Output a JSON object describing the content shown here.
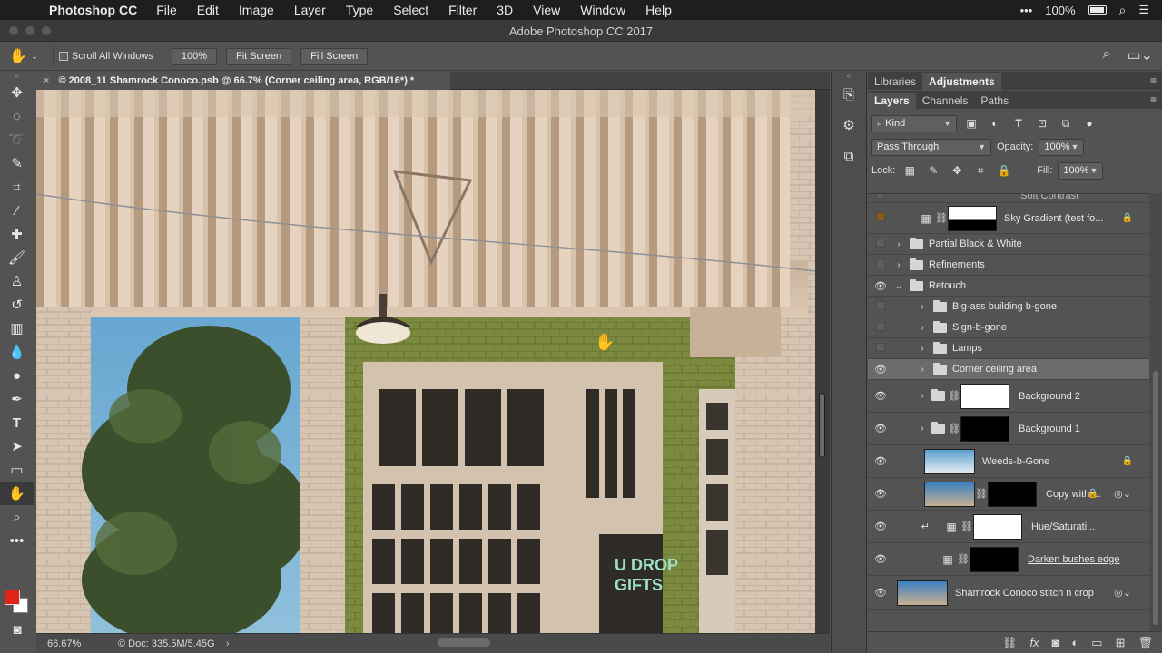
{
  "menubar": {
    "app_name": "Photoshop CC",
    "items": [
      "File",
      "Edit",
      "Image",
      "Layer",
      "Type",
      "Select",
      "Filter",
      "3D",
      "View",
      "Window",
      "Help"
    ],
    "battery": "100%"
  },
  "window": {
    "title": "Adobe Photoshop CC 2017"
  },
  "options": {
    "scroll_all_windows": "Scroll All Windows",
    "zoom_btn": "100%",
    "fit_screen": "Fit Screen",
    "fill_screen": "Fill Screen"
  },
  "document": {
    "tab_title": "© 2008_11 Shamrock Conoco.psb @ 66.7% (Corner ceiling area, RGB/16*) *",
    "zoom": "66.67%",
    "doc_size": "Doc: 335.5M/5.45G"
  },
  "canvas": {
    "sign_line1": "U DROP",
    "sign_line2": "GIFTS"
  },
  "panels": {
    "top_tabs": [
      "Libraries",
      "Adjustments"
    ],
    "layer_tabs": [
      "Layers",
      "Channels",
      "Paths"
    ],
    "filter_kind": "Kind",
    "blend_mode": "Pass Through",
    "opacity_label": "Opacity:",
    "opacity_value": "100%",
    "lock_label": "Lock:",
    "fill_label": "Fill:",
    "fill_value": "100%"
  },
  "layers": [
    {
      "name": "Soft Contrast",
      "visible": false,
      "kind": "partial"
    },
    {
      "name": "Sky Gradient (test fo...",
      "visible": false,
      "kind": "adjust-mask",
      "locked": true
    },
    {
      "name": "Partial Black & White",
      "visible": false,
      "kind": "group"
    },
    {
      "name": "Refinements",
      "visible": false,
      "kind": "group"
    },
    {
      "name": "Retouch",
      "visible": true,
      "kind": "group-open"
    },
    {
      "name": "Big-ass building b-gone",
      "visible": false,
      "kind": "subgroup"
    },
    {
      "name": "Sign-b-gone",
      "visible": false,
      "kind": "subgroup"
    },
    {
      "name": "Lamps",
      "visible": false,
      "kind": "subgroup"
    },
    {
      "name": "Corner ceiling area",
      "visible": true,
      "kind": "subgroup",
      "selected": true
    },
    {
      "name": "Background 2",
      "visible": true,
      "kind": "subgroup-mask"
    },
    {
      "name": "Background 1",
      "visible": true,
      "kind": "subgroup-mask"
    },
    {
      "name": "Weeds-b-Gone",
      "visible": true,
      "kind": "pixel",
      "locked": true
    },
    {
      "name": "Copy with ...",
      "visible": true,
      "kind": "smart-mask"
    },
    {
      "name": "Hue/Saturati...",
      "visible": true,
      "kind": "clip-adjust"
    },
    {
      "name": "Darken bushes edge",
      "visible": true,
      "kind": "adjust-mask2"
    },
    {
      "name": "Shamrock Conoco stitch n crop",
      "visible": true,
      "kind": "smart"
    }
  ],
  "icons": {
    "search": "search-icon",
    "hand": "hand-icon",
    "eye": "eye-icon",
    "folder": "folder-icon",
    "lock": "lock-icon"
  }
}
